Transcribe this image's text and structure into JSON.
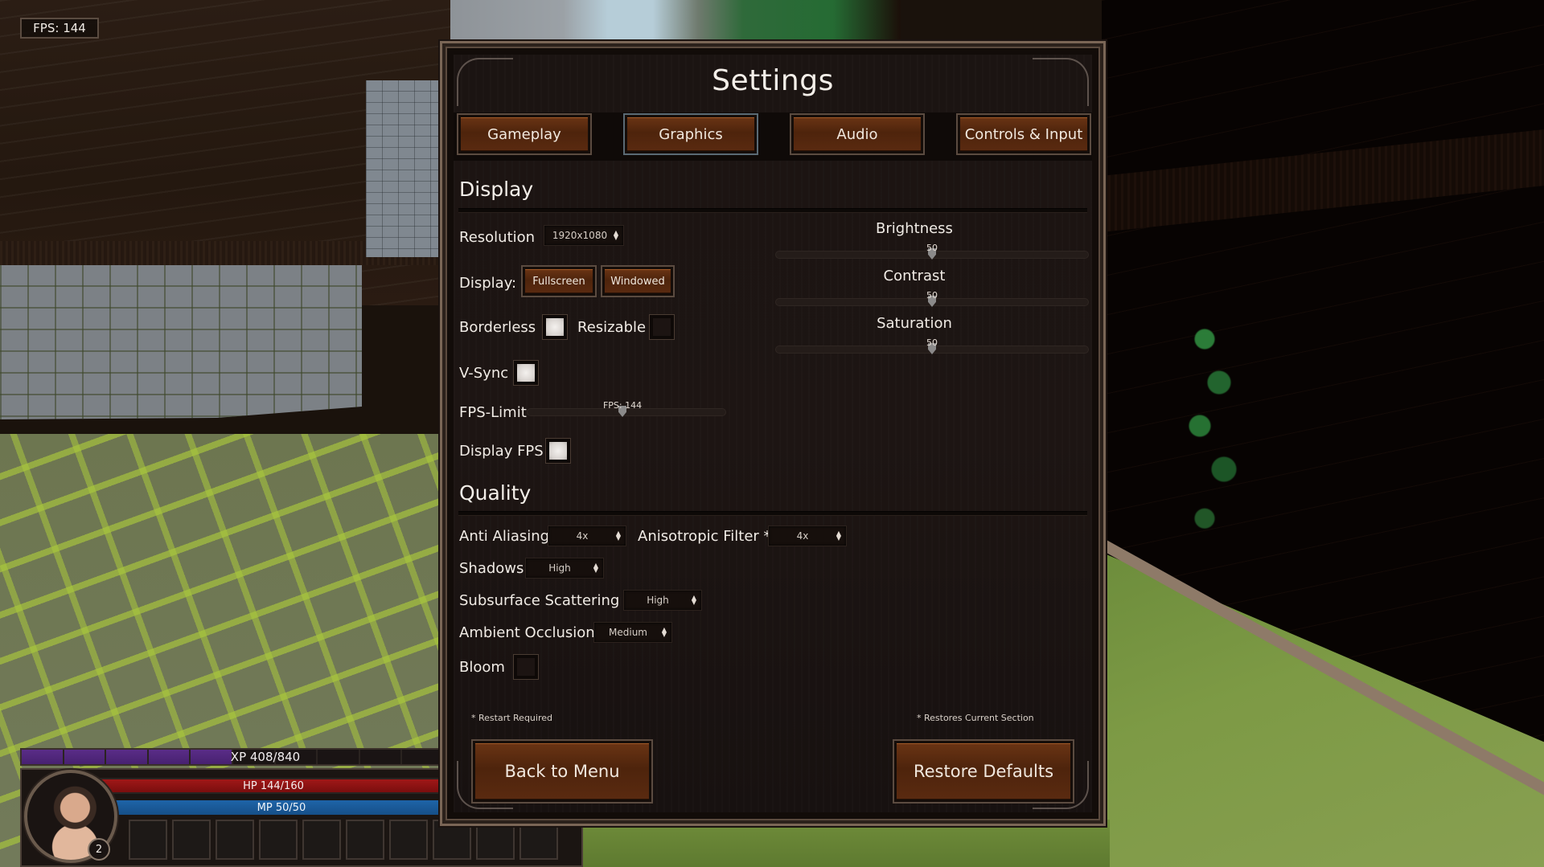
{
  "hud": {
    "fps_counter": "FPS: 144",
    "xp_text": "XP 408/840",
    "xp_fraction": 0.486,
    "hp_text": "HP 144/160",
    "mp_text": "MP 50/50",
    "level": "2",
    "hotbar_slots": 10
  },
  "settings": {
    "title": "Settings",
    "tabs": [
      {
        "label": "Gameplay",
        "active": false
      },
      {
        "label": "Graphics",
        "active": true
      },
      {
        "label": "Audio",
        "active": false
      },
      {
        "label": "Controls & Input",
        "active": false
      }
    ],
    "display": {
      "section_title": "Display",
      "resolution_label": "Resolution",
      "resolution_value": "1920x1080",
      "display_mode_label": "Display:",
      "fullscreen_label": "Fullscreen",
      "windowed_label": "Windowed",
      "borderless_label": "Borderless",
      "borderless_checked": true,
      "resizable_label": "Resizable",
      "resizable_checked": false,
      "vsync_label": "V-Sync",
      "vsync_checked": true,
      "fps_limit_label": "FPS-Limit",
      "fps_limit_value_text": "FPS: 144",
      "fps_limit_fraction": 0.48,
      "display_fps_label": "Display FPS",
      "display_fps_checked": true,
      "brightness_label": "Brightness",
      "brightness_value": 50,
      "contrast_label": "Contrast",
      "contrast_value": 50,
      "saturation_label": "Saturation",
      "saturation_value": 50
    },
    "quality": {
      "section_title": "Quality",
      "anti_aliasing_label": "Anti Aliasing",
      "anti_aliasing_value": "4x",
      "anisotropic_label": "Anisotropic Filter *",
      "anisotropic_value": "4x",
      "shadows_label": "Shadows",
      "shadows_value": "High",
      "sss_label": "Subsurface Scattering *",
      "sss_value": "High",
      "ao_label": "Ambient Occlusion",
      "ao_value": "Medium",
      "bloom_label": "Bloom",
      "bloom_checked": false
    },
    "footer": {
      "restart_note": "* Restart Required",
      "restore_note": "* Restores Current Section",
      "back_label": "Back to Menu",
      "restore_label": "Restore Defaults"
    }
  }
}
